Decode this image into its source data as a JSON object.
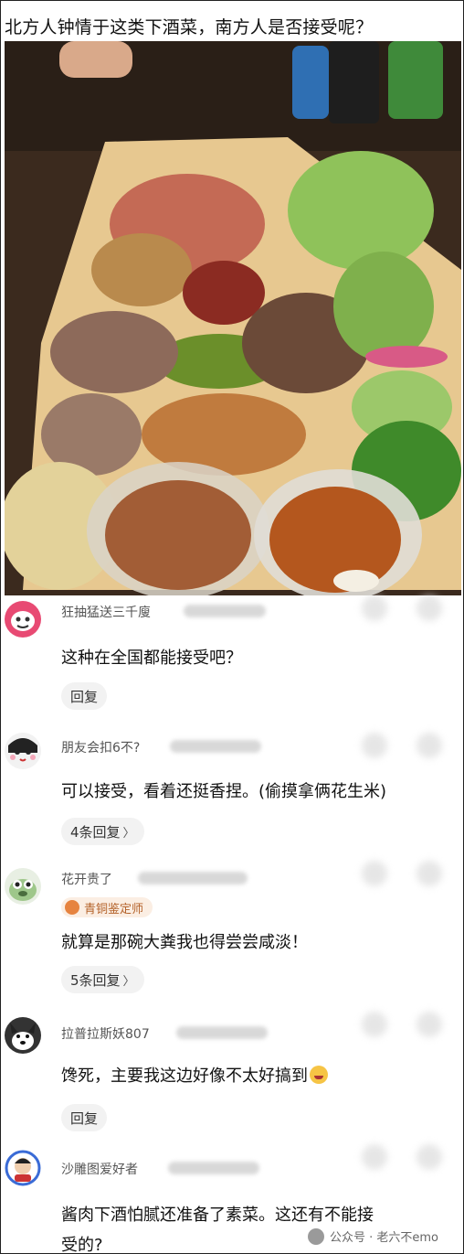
{
  "post": {
    "title": "北方人钟情于这类下酒菜，南方人是否接受呢？"
  },
  "comments": [
    {
      "username": "狂抽猛送三千廋",
      "text": "这种在全国都能接受吧？",
      "action": "回复",
      "avatar_color": "#e84a73"
    },
    {
      "username": "朋友会扣6不?",
      "text": "可以接受，看着还挺香捏。(偷摸拿俩花生米)",
      "action": "4条回复",
      "avatar_color": "#f2f2f2"
    },
    {
      "username": "花开贵了",
      "badge": "青铜鉴定师",
      "text": "就算是那碗大粪我也得尝尝咸淡！",
      "action": "5条回复",
      "avatar_color": "#e8efe3"
    },
    {
      "username": "拉普拉斯妖807",
      "text": "馋死，主要我这边好像不太好搞到",
      "action": "回复",
      "avatar_color": "#333333"
    },
    {
      "username": "沙雕图爱好者",
      "text_line1": "酱肉下酒怕腻还准备了素菜。这还有不能接",
      "text_line2": "受的?",
      "avatar_color": "#3a6bd6"
    }
  ],
  "watermark": {
    "text": "公众号 · 老六不emo"
  }
}
